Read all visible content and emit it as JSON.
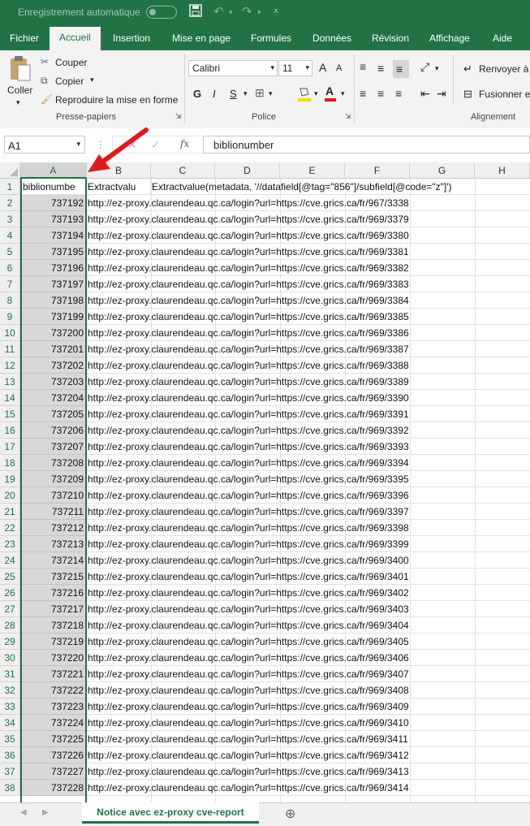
{
  "titlebar": {
    "autosave_label": "Enregistrement automatique"
  },
  "tabs": [
    "Fichier",
    "Accueil",
    "Insertion",
    "Mise en page",
    "Formules",
    "Données",
    "Révision",
    "Affichage",
    "Aide"
  ],
  "ribbon": {
    "paste": "Coller",
    "cut": "Couper",
    "copy": "Copier",
    "format_painter": "Reproduire la mise en forme",
    "clipboard_group": "Presse-papiers",
    "font_name": "Calibri",
    "font_size": "11",
    "grow_font": "A",
    "shrink_font": "A",
    "bold": "G",
    "italic": "I",
    "underline": "S",
    "font_color_letter": "A",
    "font_group": "Police",
    "wrap_text": "Renvoyer à l",
    "merge": "Fusionner et",
    "alignment_group": "Alignement"
  },
  "formula_bar": {
    "name_box": "A1",
    "fx": "fx",
    "formula": "biblionumber"
  },
  "columns": [
    "A",
    "B",
    "C",
    "D",
    "E",
    "F",
    "G",
    "H"
  ],
  "grid": {
    "header_row": {
      "num": "1",
      "a": "biblionumbe",
      "b": "Extractvalu",
      "c": "Extractvalue(metadata, '//datafield[@tag=\"856\"]/subfield[@code=\"z\"]')"
    },
    "rows": [
      {
        "num": "2",
        "a": "737192",
        "b": "http://ez-proxy.claurendeau.qc.ca/login?url=https://cve.grics.ca/fr/967/3338"
      },
      {
        "num": "3",
        "a": "737193",
        "b": "http://ez-proxy.claurendeau.qc.ca/login?url=https://cve.grics.ca/fr/969/3379"
      },
      {
        "num": "4",
        "a": "737194",
        "b": "http://ez-proxy.claurendeau.qc.ca/login?url=https://cve.grics.ca/fr/969/3380"
      },
      {
        "num": "5",
        "a": "737195",
        "b": "http://ez-proxy.claurendeau.qc.ca/login?url=https://cve.grics.ca/fr/969/3381"
      },
      {
        "num": "6",
        "a": "737196",
        "b": "http://ez-proxy.claurendeau.qc.ca/login?url=https://cve.grics.ca/fr/969/3382"
      },
      {
        "num": "7",
        "a": "737197",
        "b": "http://ez-proxy.claurendeau.qc.ca/login?url=https://cve.grics.ca/fr/969/3383"
      },
      {
        "num": "8",
        "a": "737198",
        "b": "http://ez-proxy.claurendeau.qc.ca/login?url=https://cve.grics.ca/fr/969/3384"
      },
      {
        "num": "9",
        "a": "737199",
        "b": "http://ez-proxy.claurendeau.qc.ca/login?url=https://cve.grics.ca/fr/969/3385"
      },
      {
        "num": "10",
        "a": "737200",
        "b": "http://ez-proxy.claurendeau.qc.ca/login?url=https://cve.grics.ca/fr/969/3386"
      },
      {
        "num": "11",
        "a": "737201",
        "b": "http://ez-proxy.claurendeau.qc.ca/login?url=https://cve.grics.ca/fr/969/3387"
      },
      {
        "num": "12",
        "a": "737202",
        "b": "http://ez-proxy.claurendeau.qc.ca/login?url=https://cve.grics.ca/fr/969/3388"
      },
      {
        "num": "13",
        "a": "737203",
        "b": "http://ez-proxy.claurendeau.qc.ca/login?url=https://cve.grics.ca/fr/969/3389"
      },
      {
        "num": "14",
        "a": "737204",
        "b": "http://ez-proxy.claurendeau.qc.ca/login?url=https://cve.grics.ca/fr/969/3390"
      },
      {
        "num": "15",
        "a": "737205",
        "b": "http://ez-proxy.claurendeau.qc.ca/login?url=https://cve.grics.ca/fr/969/3391"
      },
      {
        "num": "16",
        "a": "737206",
        "b": "http://ez-proxy.claurendeau.qc.ca/login?url=https://cve.grics.ca/fr/969/3392"
      },
      {
        "num": "17",
        "a": "737207",
        "b": "http://ez-proxy.claurendeau.qc.ca/login?url=https://cve.grics.ca/fr/969/3393"
      },
      {
        "num": "18",
        "a": "737208",
        "b": "http://ez-proxy.claurendeau.qc.ca/login?url=https://cve.grics.ca/fr/969/3394"
      },
      {
        "num": "19",
        "a": "737209",
        "b": "http://ez-proxy.claurendeau.qc.ca/login?url=https://cve.grics.ca/fr/969/3395"
      },
      {
        "num": "20",
        "a": "737210",
        "b": "http://ez-proxy.claurendeau.qc.ca/login?url=https://cve.grics.ca/fr/969/3396"
      },
      {
        "num": "21",
        "a": "737211",
        "b": "http://ez-proxy.claurendeau.qc.ca/login?url=https://cve.grics.ca/fr/969/3397"
      },
      {
        "num": "22",
        "a": "737212",
        "b": "http://ez-proxy.claurendeau.qc.ca/login?url=https://cve.grics.ca/fr/969/3398"
      },
      {
        "num": "23",
        "a": "737213",
        "b": "http://ez-proxy.claurendeau.qc.ca/login?url=https://cve.grics.ca/fr/969/3399"
      },
      {
        "num": "24",
        "a": "737214",
        "b": "http://ez-proxy.claurendeau.qc.ca/login?url=https://cve.grics.ca/fr/969/3400"
      },
      {
        "num": "25",
        "a": "737215",
        "b": "http://ez-proxy.claurendeau.qc.ca/login?url=https://cve.grics.ca/fr/969/3401"
      },
      {
        "num": "26",
        "a": "737216",
        "b": "http://ez-proxy.claurendeau.qc.ca/login?url=https://cve.grics.ca/fr/969/3402"
      },
      {
        "num": "27",
        "a": "737217",
        "b": "http://ez-proxy.claurendeau.qc.ca/login?url=https://cve.grics.ca/fr/969/3403"
      },
      {
        "num": "28",
        "a": "737218",
        "b": "http://ez-proxy.claurendeau.qc.ca/login?url=https://cve.grics.ca/fr/969/3404"
      },
      {
        "num": "29",
        "a": "737219",
        "b": "http://ez-proxy.claurendeau.qc.ca/login?url=https://cve.grics.ca/fr/969/3405"
      },
      {
        "num": "30",
        "a": "737220",
        "b": "http://ez-proxy.claurendeau.qc.ca/login?url=https://cve.grics.ca/fr/969/3406"
      },
      {
        "num": "31",
        "a": "737221",
        "b": "http://ez-proxy.claurendeau.qc.ca/login?url=https://cve.grics.ca/fr/969/3407"
      },
      {
        "num": "32",
        "a": "737222",
        "b": "http://ez-proxy.claurendeau.qc.ca/login?url=https://cve.grics.ca/fr/969/3408"
      },
      {
        "num": "33",
        "a": "737223",
        "b": "http://ez-proxy.claurendeau.qc.ca/login?url=https://cve.grics.ca/fr/969/3409"
      },
      {
        "num": "34",
        "a": "737224",
        "b": "http://ez-proxy.claurendeau.qc.ca/login?url=https://cve.grics.ca/fr/969/3410"
      },
      {
        "num": "35",
        "a": "737225",
        "b": "http://ez-proxy.claurendeau.qc.ca/login?url=https://cve.grics.ca/fr/969/3411"
      },
      {
        "num": "36",
        "a": "737226",
        "b": "http://ez-proxy.claurendeau.qc.ca/login?url=https://cve.grics.ca/fr/969/3412"
      },
      {
        "num": "37",
        "a": "737227",
        "b": "http://ez-proxy.claurendeau.qc.ca/login?url=https://cve.grics.ca/fr/969/3413"
      },
      {
        "num": "38",
        "a": "737228",
        "b": "http://ez-proxy.claurendeau.qc.ca/login?url=https://cve.grics.ca/fr/969/3414"
      }
    ]
  },
  "sheet_tab": "Notice avec ez-proxy cve-report",
  "colors": {
    "excel_green": "#217346",
    "arrow_red": "#e01b1b"
  },
  "icons": [
    "save-icon",
    "undo-icon",
    "redo-icon",
    "customize-icon",
    "cut-icon",
    "copy-icon",
    "format-painter-icon",
    "paste-icon",
    "cancel-icon",
    "enter-icon",
    "add-sheet-icon"
  ]
}
